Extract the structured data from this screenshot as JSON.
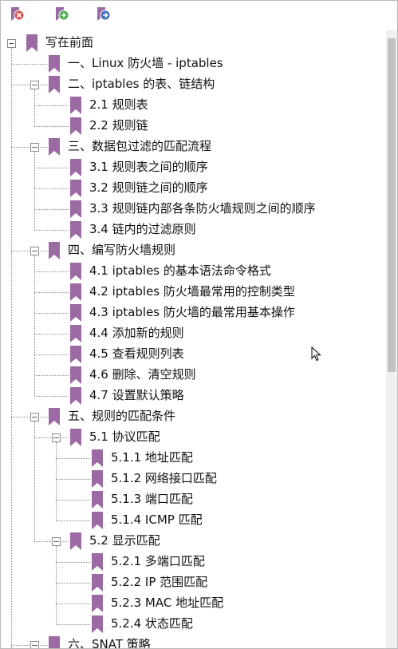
{
  "toolbar": {
    "buttons": [
      {
        "name": "remove-bookmark-button",
        "icon": "bookmark-remove-icon",
        "color": "#d9534f"
      },
      {
        "name": "add-bookmark-button",
        "icon": "bookmark-add-icon",
        "color": "#4caf50"
      },
      {
        "name": "goto-bookmark-button",
        "icon": "bookmark-goto-icon",
        "color": "#3f6fb5"
      }
    ]
  },
  "colors": {
    "bookmark": "#9b6aa3",
    "tree_line": "#8c8c8c"
  },
  "tree": {
    "items": [
      {
        "label": "写在前面",
        "level": 0,
        "expanded": true
      },
      {
        "label": "一、Linux 防火墙 - iptables",
        "level": 1
      },
      {
        "label": "二、iptables 的表、链结构",
        "level": 1,
        "expanded": true
      },
      {
        "label": "2.1 规则表",
        "level": 2
      },
      {
        "label": "2.2 规则链",
        "level": 2
      },
      {
        "label": "三、数据包过滤的匹配流程",
        "level": 1,
        "expanded": true
      },
      {
        "label": "3.1 规则表之间的顺序",
        "level": 2
      },
      {
        "label": "3.2 规则链之间的顺序",
        "level": 2
      },
      {
        "label": "3.3 规则链内部各条防火墙规则之间的顺序",
        "level": 2
      },
      {
        "label": "3.4 链内的过滤原则",
        "level": 2
      },
      {
        "label": "四、编写防火墙规则",
        "level": 1,
        "expanded": true
      },
      {
        "label": "4.1 iptables 的基本语法命令格式",
        "level": 2
      },
      {
        "label": "4.2 iptables 防火墙最常用的控制类型",
        "level": 2
      },
      {
        "label": "4.3 iptables 防火墙的最常用基本操作",
        "level": 2
      },
      {
        "label": "4.4 添加新的规则",
        "level": 2
      },
      {
        "label": "4.5 查看规则列表",
        "level": 2
      },
      {
        "label": "4.6 删除、清空规则",
        "level": 2
      },
      {
        "label": "4.7 设置默认策略",
        "level": 2
      },
      {
        "label": "五、规则的匹配条件",
        "level": 1,
        "expanded": true
      },
      {
        "label": "5.1 协议匹配",
        "level": 2,
        "expanded": true
      },
      {
        "label": "5.1.1 地址匹配",
        "level": 3
      },
      {
        "label": "5.1.2 网络接口匹配",
        "level": 3
      },
      {
        "label": "5.1.3 端口匹配",
        "level": 3
      },
      {
        "label": "5.1.4 ICMP 匹配",
        "level": 3
      },
      {
        "label": "5.2 显示匹配",
        "level": 2,
        "expanded": true
      },
      {
        "label": "5.2.1 多端口匹配",
        "level": 3
      },
      {
        "label": "5.2.2 IP 范围匹配",
        "level": 3
      },
      {
        "label": "5.2.3 MAC 地址匹配",
        "level": 3
      },
      {
        "label": "5.2.4 状态匹配",
        "level": 3
      },
      {
        "label": "六、SNAT 策略",
        "level": 1,
        "expanded": true
      }
    ]
  }
}
